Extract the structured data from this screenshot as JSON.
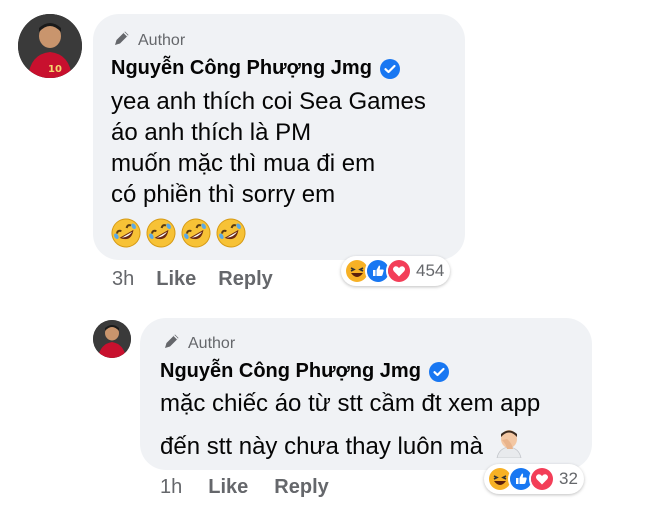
{
  "comments": [
    {
      "author_tag": "Author",
      "name": "Nguyễn Công Phượng Jmg",
      "lines": [
        "yea anh thích coi Sea Games",
        "áo anh thích là PM",
        "muốn mặc thì mua đi em",
        "có phiền thì sorry em"
      ],
      "emoji_line": "rolling-on-floor-laughing x4",
      "time": "3h",
      "like_label": "Like",
      "reply_label": "Reply",
      "reactions": [
        "haha",
        "like",
        "love"
      ],
      "reaction_count": "454"
    },
    {
      "author_tag": "Author",
      "name": "Nguyễn Công Phượng Jmg",
      "lines": [
        "mặc chiếc áo từ stt cầm đt xem app",
        "đến stt này chưa thay luôn mà"
      ],
      "trailing_emoji": "man-facepalming",
      "time": "1h",
      "like_label": "Like",
      "reply_label": "Reply",
      "reactions": [
        "haha",
        "like",
        "love"
      ],
      "reaction_count": "32"
    }
  ],
  "colors": {
    "bubble": "#f0f2f5",
    "secondary_text": "#65676b",
    "verified": "#1877f2",
    "like": "#1877f2",
    "love": "#f33e58",
    "haha": "#f7b125"
  }
}
